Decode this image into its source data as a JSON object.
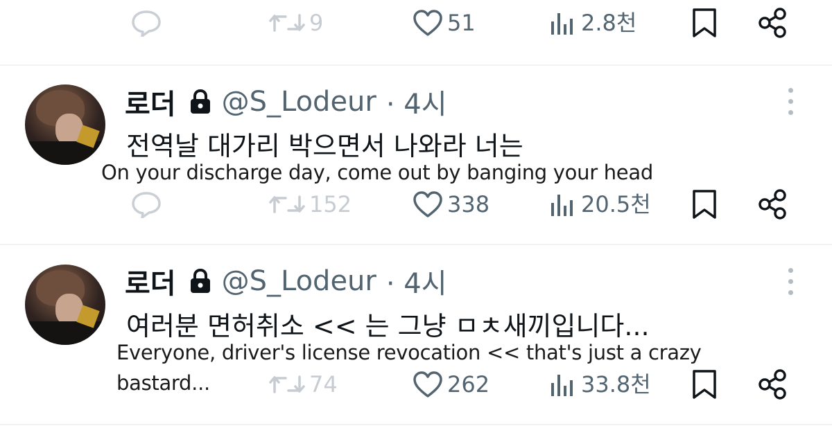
{
  "tweets": [
    {
      "stats": {
        "retweets": "9",
        "likes": "51",
        "views": "2.8천"
      }
    },
    {
      "author": {
        "display_name": "로더",
        "handle": "@S_Lodeur",
        "time": "· 4시"
      },
      "text": "전역날 대가리 박으면서 나와라 너는",
      "translation_lines": [
        "On your discharge day, come out by banging your head"
      ],
      "stats": {
        "retweets": "152",
        "likes": "338",
        "views": "20.5천"
      }
    },
    {
      "author": {
        "display_name": "로더",
        "handle": "@S_Lodeur",
        "time": "· 4시"
      },
      "text": "여러분 면허취소 << 는 그냥 ㅁㅊ새끼입니다...",
      "translation_lines": [
        "Everyone, driver's license revocation << that's just a crazy",
        "bastard..."
      ],
      "stats": {
        "retweets": "74",
        "likes": "262",
        "views": "33.8천"
      }
    }
  ],
  "icons": {
    "reply": "reply-icon",
    "retweet": "retweet-icon",
    "like": "heart-icon",
    "views": "views-icon",
    "bookmark": "bookmark-icon",
    "share": "share-icon",
    "lock": "lock-icon",
    "more": "more-icon"
  },
  "colors": {
    "text": "#0f1419",
    "secondary": "#536471",
    "faded": "#c6ccd2",
    "divider": "#eff3f4"
  }
}
